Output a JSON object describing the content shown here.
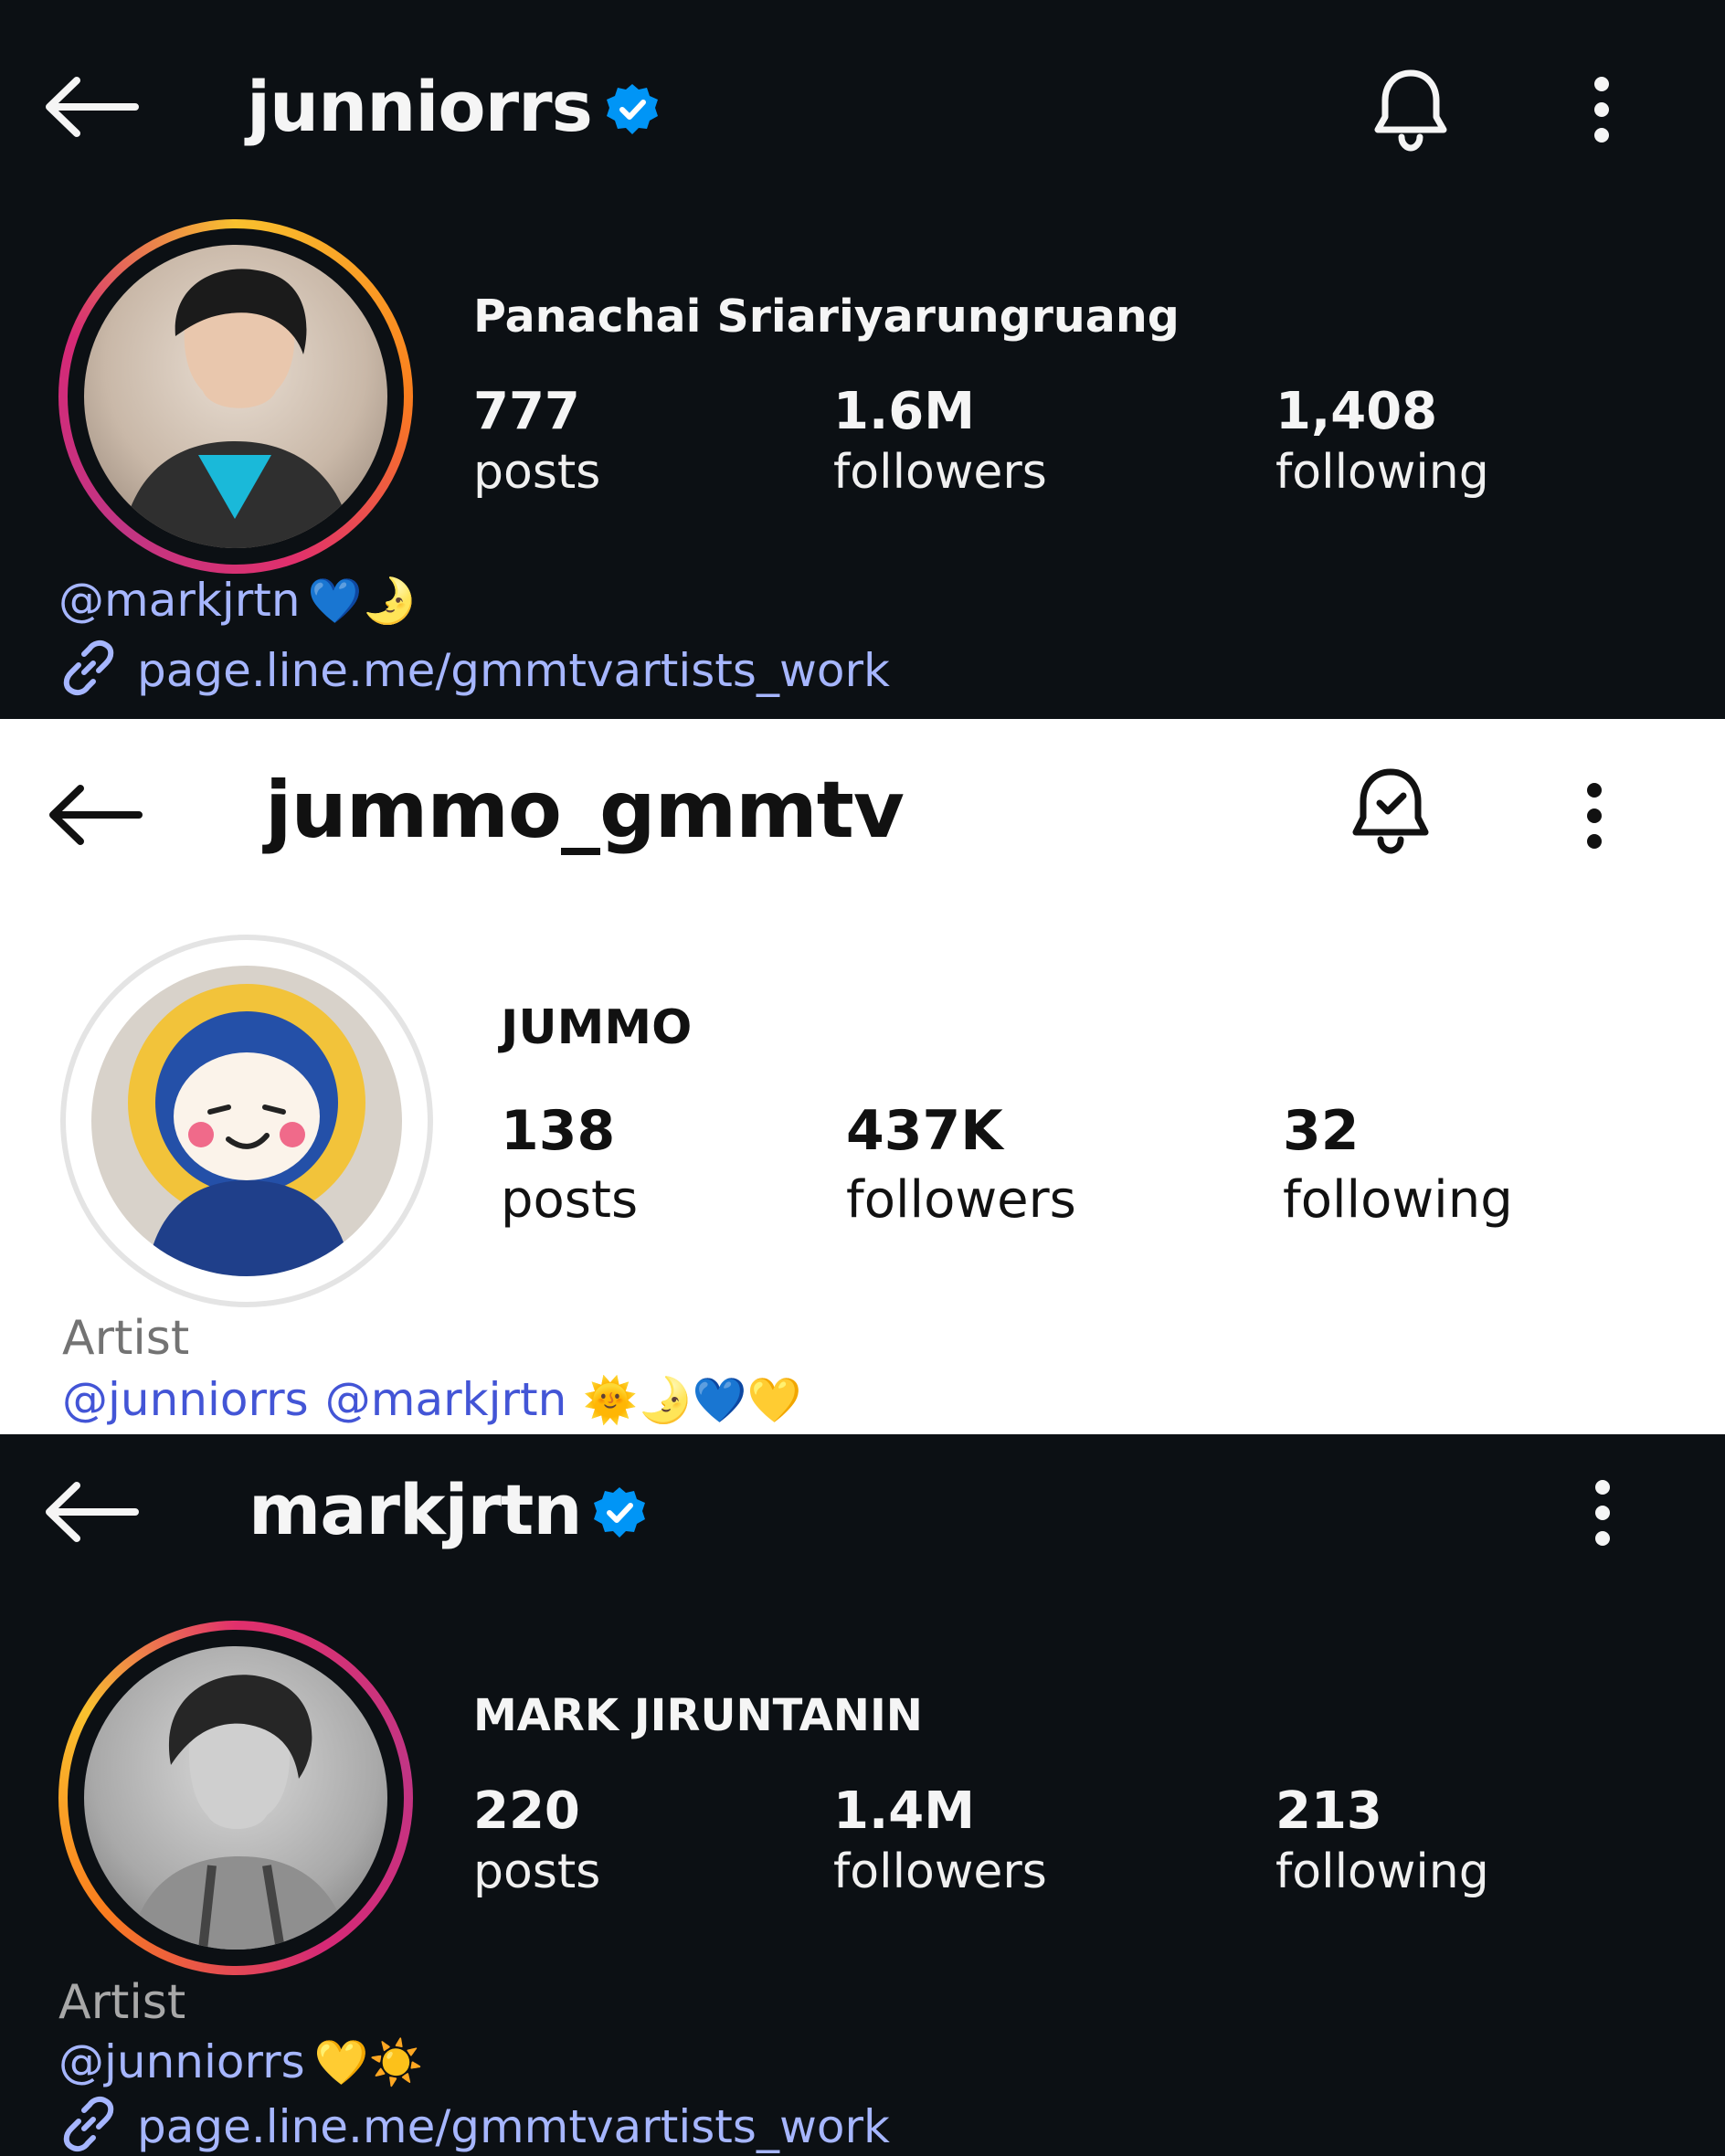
{
  "colors": {
    "dark_bg": "#0c1014",
    "verified_blue": "#0095f6",
    "link_dark": "#a6b6ff",
    "link_light": "#4355d6",
    "story_ring": [
      "#feda75",
      "#fa7e1e",
      "#d62976",
      "#962fbf"
    ]
  },
  "profiles": [
    {
      "handle": "junniorrs",
      "verified": true,
      "notification_icon": "bell-icon",
      "name": "Panachai Sriariyarungruang",
      "stats": {
        "posts": {
          "value": "777",
          "label": "posts"
        },
        "followers": {
          "value": "1.6M",
          "label": "followers"
        },
        "following": {
          "value": "1,408",
          "label": "following"
        }
      },
      "bio": {
        "mention": "@markjrtn",
        "emojis": "💙🌛",
        "link": "page.line.me/gmmtvartists_work"
      }
    },
    {
      "handle": "jummo_gmmtv",
      "verified": false,
      "notification_icon": "bell-check-icon",
      "name": "JUMMO",
      "stats": {
        "posts": {
          "value": "138",
          "label": "posts"
        },
        "followers": {
          "value": "437K",
          "label": "followers"
        },
        "following": {
          "value": "32",
          "label": "following"
        }
      },
      "bio": {
        "category": "Artist",
        "mention_1": "@junniorrs",
        "mention_2": "@markjrtn",
        "emojis": "🌞🌛💙💛"
      }
    },
    {
      "handle": "markjrtn",
      "verified": true,
      "name": "MARK JIRUNTANIN",
      "stats": {
        "posts": {
          "value": "220",
          "label": "posts"
        },
        "followers": {
          "value": "1.4M",
          "label": "followers"
        },
        "following": {
          "value": "213",
          "label": "following"
        }
      },
      "bio": {
        "category": "Artist",
        "mention": "@junniorrs",
        "emojis": "💛☀️",
        "link": "page.line.me/gmmtvartists_work"
      }
    }
  ]
}
